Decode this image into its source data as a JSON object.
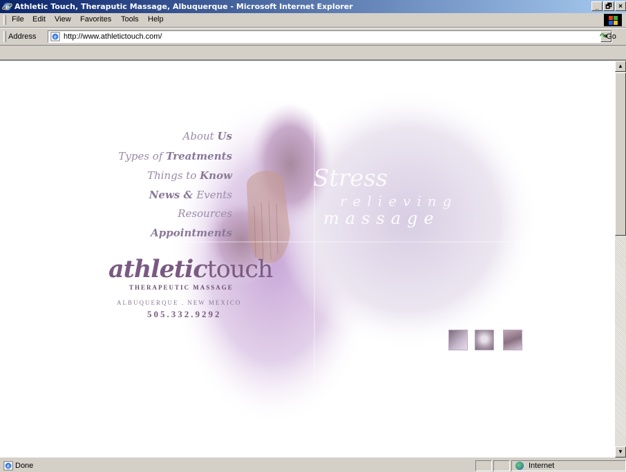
{
  "window": {
    "title": "Athletic Touch, Theraputic Massage, Albuquerque - Microsoft Internet Explorer",
    "controls": [
      "_",
      "🗗",
      "×"
    ]
  },
  "menu": {
    "items": [
      "File",
      "Edit",
      "View",
      "Favorites",
      "Tools",
      "Help"
    ]
  },
  "address": {
    "label": "Address",
    "url": "http://www.athletictouch.com/",
    "go_label": "Go"
  },
  "page": {
    "nav": [
      {
        "pre": "About ",
        "bold": "Us"
      },
      {
        "pre": "Types of ",
        "bold": "Treatments"
      },
      {
        "pre": "Things to ",
        "bold": "Know"
      },
      {
        "pre": "",
        "bold": "News & ",
        "post": "Events"
      },
      {
        "pre": "Resources",
        "bold": ""
      },
      {
        "pre": "",
        "bold": "Appointments"
      }
    ],
    "logo_main": "athletic",
    "logo_second": "touch",
    "logo_sub": "THERAPEUTIC MASSAGE",
    "location": "ALBUQUERQUE . NEW MEXICO",
    "phone": "505.332.9292",
    "tagline_1": "Stress",
    "tagline_2": "relieving",
    "tagline_3": "massage"
  },
  "status": {
    "text": "Done",
    "zone": "Internet"
  },
  "colors": {
    "accent_purple": "#7a5a82",
    "nav_text": "#9a8aa8",
    "titlebar_start": "#0a246a",
    "titlebar_end": "#a6caf0"
  }
}
